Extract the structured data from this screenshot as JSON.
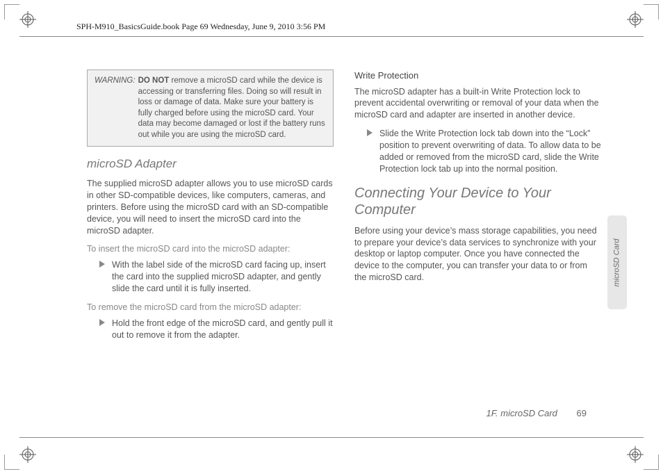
{
  "meta": {
    "header": "SPH-M910_BasicsGuide.book  Page 69  Wednesday, June 9, 2010  3:56 PM"
  },
  "warning": {
    "label": "WARNING:",
    "bold": "DO NOT",
    "rest": " remove a microSD card while the device is accessing or transferring files. Doing so will result in loss or damage of data. Make sure your battery is fully charged before using the microSD card. Your data may become damaged or lost if the battery runs out while you are using the microSD card."
  },
  "left": {
    "h_adapter": "microSD Adapter",
    "p_adapter": "The supplied microSD adapter allows you to use microSD cards in other SD-compatible devices, like computers, cameras, and printers. Before using the microSD card with an SD-compatible device, you will need to insert the microSD card into the microSD adapter.",
    "sub_insert": "To insert the microSD card into the microSD adapter:",
    "b_insert": "With the label side of the microSD card facing up, insert the card into the supplied microSD adapter, and gently slide the card until it is fully inserted.",
    "sub_remove": "To remove the microSD card from the microSD adapter:",
    "b_remove": "Hold the front edge of the microSD card, and gently pull it out to remove it from the adapter."
  },
  "right": {
    "h_write": "Write Protection",
    "p_write": "The microSD adapter has a built-in Write Protection lock to prevent accidental overwriting or removal of your data when the microSD card and adapter are inserted in another device.",
    "b_write": "Slide the Write Protection lock tab down into the “Lock” position to prevent overwriting of data. To allow data to be added or removed from the microSD card, slide the Write Protection lock tab up into the normal position.",
    "h_connect": "Connecting Your Device to Your Computer",
    "p_connect": "Before using your device’s mass storage capabilities, you need to prepare your device’s data services to synchronize with your desktop or laptop computer. Once you have connected the device to the computer, you can transfer your data to or from the microSD card."
  },
  "footer": {
    "section": "1F. microSD Card",
    "page": "69"
  },
  "sidetab": "microSD Card"
}
